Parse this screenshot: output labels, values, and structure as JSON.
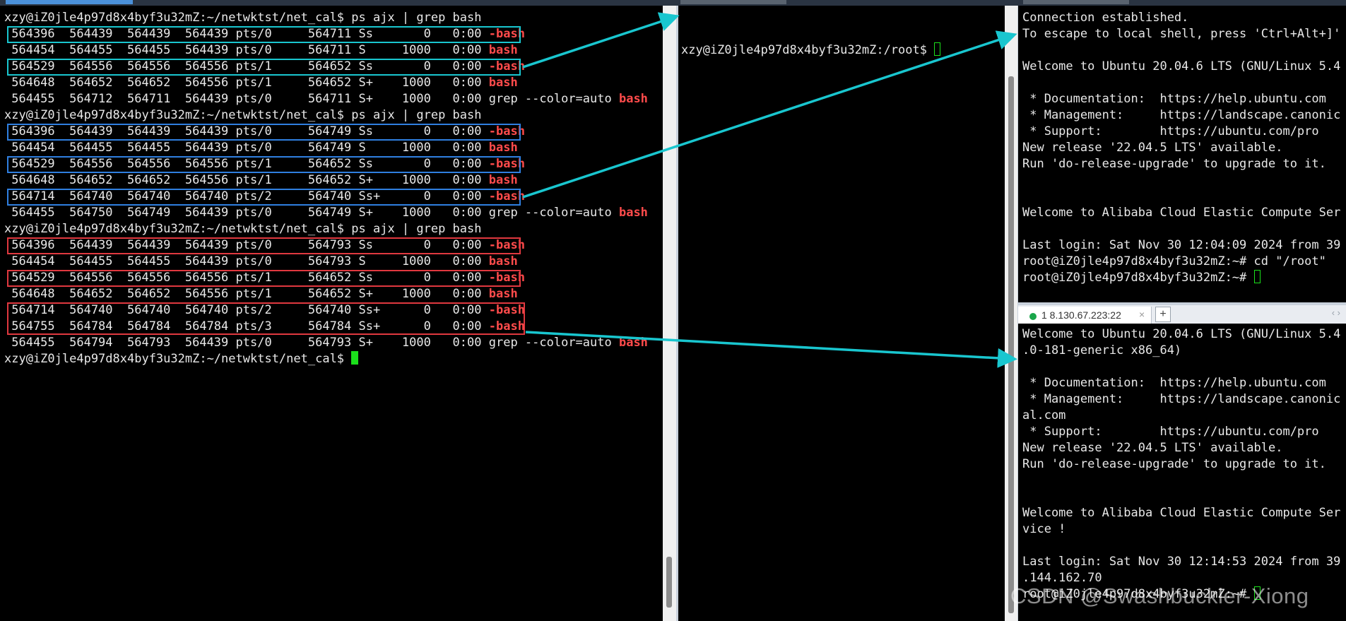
{
  "left_terminal": {
    "lines": [
      "xzy@iZ0jle4p97d8x4byf3u32mZ:~/netwktst/net_cal$ ps ajx | grep bash",
      [
        " 564396  564439  564439  564439 pts/0     564711 Ss       0   0:00 ",
        "-bash"
      ],
      [
        " 564454  564455  564455  564439 pts/0     564711 S     1000   0:00 ",
        "bash"
      ],
      [
        " 564529  564556  564556  564556 pts/1     564652 Ss       0   0:00 ",
        "-bash"
      ],
      [
        " 564648  564652  564652  564556 pts/1     564652 S+    1000   0:00 ",
        "bash"
      ],
      [
        " 564455  564712  564711  564439 pts/0     564711 S+    1000   0:00 grep --color=auto ",
        "bash"
      ],
      "xzy@iZ0jle4p97d8x4byf3u32mZ:~/netwktst/net_cal$ ps ajx | grep bash",
      [
        " 564396  564439  564439  564439 pts/0     564749 Ss       0   0:00 ",
        "-bash"
      ],
      [
        " 564454  564455  564455  564439 pts/0     564749 S     1000   0:00 ",
        "bash"
      ],
      [
        " 564529  564556  564556  564556 pts/1     564652 Ss       0   0:00 ",
        "-bash"
      ],
      [
        " 564648  564652  564652  564556 pts/1     564652 S+    1000   0:00 ",
        "bash"
      ],
      [
        " 564714  564740  564740  564740 pts/2     564740 Ss+      0   0:00 ",
        "-bash"
      ],
      [
        " 564455  564750  564749  564439 pts/0     564749 S+    1000   0:00 grep --color=auto ",
        "bash"
      ],
      "xzy@iZ0jle4p97d8x4byf3u32mZ:~/netwktst/net_cal$ ps ajx | grep bash",
      [
        " 564396  564439  564439  564439 pts/0     564793 Ss       0   0:00 ",
        "-bash"
      ],
      [
        " 564454  564455  564455  564439 pts/0     564793 S     1000   0:00 ",
        "bash"
      ],
      [
        " 564529  564556  564556  564556 pts/1     564652 Ss       0   0:00 ",
        "-bash"
      ],
      [
        " 564648  564652  564652  564556 pts/1     564652 S+    1000   0:00 ",
        "bash"
      ],
      [
        " 564714  564740  564740  564740 pts/2     564740 Ss+      0   0:00 ",
        "-bash"
      ],
      [
        " 564755  564784  564784  564784 pts/3     564784 Ss+      0   0:00 ",
        "-bash"
      ],
      [
        " 564455  564794  564793  564439 pts/0     564793 S+    1000   0:00 grep --color=auto ",
        "bash"
      ]
    ],
    "prompt": "xzy@iZ0jle4p97d8x4byf3u32mZ:~/netwktst/net_cal$ "
  },
  "middle_terminal": {
    "prompt": "xzy@iZ0jle4p97d8x4byf3u32mZ:/root$ "
  },
  "top_right_terminal": {
    "lines": [
      "Connection established.",
      "To escape to local shell, press 'Ctrl+Alt+]'",
      "",
      "Welcome to Ubuntu 20.04.6 LTS (GNU/Linux 5.4",
      "",
      " * Documentation:  https://help.ubuntu.com",
      " * Management:     https://landscape.canonic",
      " * Support:        https://ubuntu.com/pro",
      "New release '22.04.5 LTS' available.",
      "Run 'do-release-upgrade' to upgrade to it.",
      "",
      "",
      "Welcome to Alibaba Cloud Elastic Compute Ser",
      "",
      "Last login: Sat Nov 30 12:04:09 2024 from 39",
      "root@iZ0jle4p97d8x4byf3u32mZ:~# cd \"/root\""
    ],
    "prompt": "root@iZ0jle4p97d8x4byf3u32mZ:~# "
  },
  "bottom_right_tab": {
    "label": "1 8.130.67.223:22",
    "close": "×",
    "add": "+",
    "nav": "‹  ›"
  },
  "bottom_right_terminal": {
    "lines": [
      "Welcome to Ubuntu 20.04.6 LTS (GNU/Linux 5.4",
      ".0-181-generic x86_64)",
      "",
      " * Documentation:  https://help.ubuntu.com",
      " * Management:     https://landscape.canonic",
      "al.com",
      " * Support:        https://ubuntu.com/pro",
      "New release '22.04.5 LTS' available.",
      "Run 'do-release-upgrade' to upgrade to it.",
      "",
      "",
      "Welcome to Alibaba Cloud Elastic Compute Ser",
      "vice !",
      "",
      "Last login: Sat Nov 30 12:14:53 2024 from 39",
      ".144.162.70",
      "root@iZ0jle4p97d8x4byf3u32mZ:~# "
    ]
  },
  "watermark": "CSDN @Swashbuckler-Xiong",
  "colors": {
    "terminal_bg": "#000000",
    "text": "#e8e8e8",
    "highlight_red": "#ff4b4b",
    "box_cyan": "#19c6cf",
    "box_blue": "#2f7fe0",
    "box_red": "#e0383f",
    "cursor_green": "#1be01b"
  }
}
